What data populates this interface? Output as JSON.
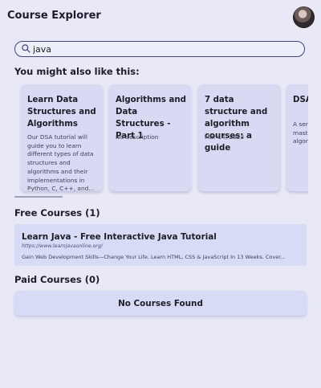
{
  "app": {
    "title": "Course Explorer"
  },
  "search": {
    "value": "java",
    "placeholder": ""
  },
  "recommendations": {
    "title": "You might also like this:",
    "cards": [
      {
        "title": "Learn Data Structures and Algorithms",
        "description": "Our DSA tutorial will guide you to learn different types of data structures and algorithms and their implementations in Python, C, C++, and..."
      },
      {
        "title": "Algorithms and Data Structures - Part 1",
        "description": "No description"
      },
      {
        "title": "7 data structure and algorithm courses: a guide",
        "description": "Mar 14, 2023 —"
      },
      {
        "title": "DSA Cou...",
        "description": "A series courses. Enjoy! masterin structure algorith and prac..."
      }
    ]
  },
  "free_courses": {
    "title": "Free Courses (1)",
    "items": [
      {
        "title": "Learn Java - Free Interactive Java Tutorial",
        "url": "https://www.learnjavaonline.org/",
        "description": "Gain Web Development Skills—Change Your Life. Learn HTML, CSS & JavaScript In 13 Weeks. Cover..."
      }
    ]
  },
  "paid_courses": {
    "title": "Paid Courses (0)",
    "empty_message": "No Courses Found"
  },
  "colors": {
    "background": "#e8e8f6",
    "card": "#d8daf4",
    "accent": "#3f467d"
  },
  "icons": {
    "search": "search-icon",
    "avatar": "avatar"
  }
}
